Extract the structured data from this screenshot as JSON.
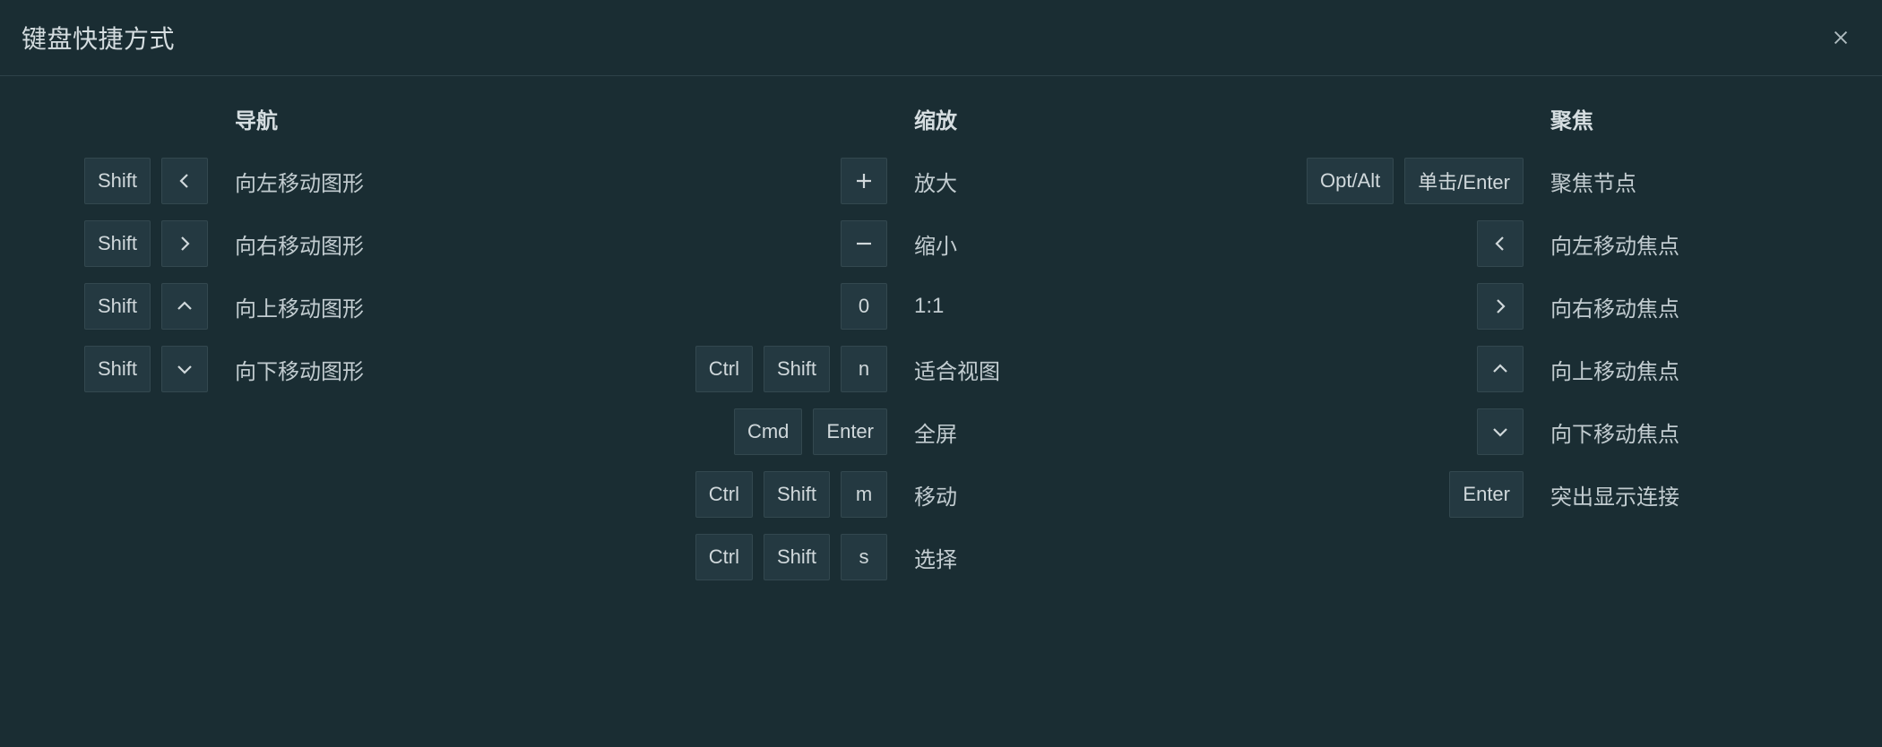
{
  "title": "键盘快捷方式",
  "columns": {
    "nav": {
      "header": "导航",
      "rows": [
        {
          "keys": [
            "Shift",
            "chevron-left"
          ],
          "label": "向左移动图形"
        },
        {
          "keys": [
            "Shift",
            "chevron-right"
          ],
          "label": "向右移动图形"
        },
        {
          "keys": [
            "Shift",
            "chevron-up"
          ],
          "label": "向上移动图形"
        },
        {
          "keys": [
            "Shift",
            "chevron-down"
          ],
          "label": "向下移动图形"
        }
      ]
    },
    "zoom": {
      "header": "缩放",
      "rows": [
        {
          "keys": [
            "plus"
          ],
          "label": "放大"
        },
        {
          "keys": [
            "minus"
          ],
          "label": "缩小"
        },
        {
          "keys": [
            "0"
          ],
          "label": "1:1"
        },
        {
          "keys": [
            "Ctrl",
            "Shift",
            "n"
          ],
          "label": "适合视图"
        },
        {
          "keys": [
            "Cmd",
            "Enter"
          ],
          "label": "全屏"
        },
        {
          "keys": [
            "Ctrl",
            "Shift",
            "m"
          ],
          "label": "移动"
        },
        {
          "keys": [
            "Ctrl",
            "Shift",
            "s"
          ],
          "label": "选择"
        }
      ]
    },
    "focus": {
      "header": "聚焦",
      "rows": [
        {
          "keys": [
            "Opt/Alt",
            "单击/Enter"
          ],
          "label": "聚焦节点"
        },
        {
          "keys": [
            "chevron-left"
          ],
          "label": "向左移动焦点"
        },
        {
          "keys": [
            "chevron-right"
          ],
          "label": "向右移动焦点"
        },
        {
          "keys": [
            "chevron-up"
          ],
          "label": "向上移动焦点"
        },
        {
          "keys": [
            "chevron-down"
          ],
          "label": "向下移动焦点"
        },
        {
          "keys": [
            "Enter"
          ],
          "label": "突出显示连接"
        }
      ]
    }
  },
  "icons": {
    "chevron-left": "chevron-left-icon",
    "chevron-right": "chevron-right-icon",
    "chevron-up": "chevron-up-icon",
    "chevron-down": "chevron-down-icon",
    "plus": "plus-icon",
    "minus": "minus-icon"
  }
}
